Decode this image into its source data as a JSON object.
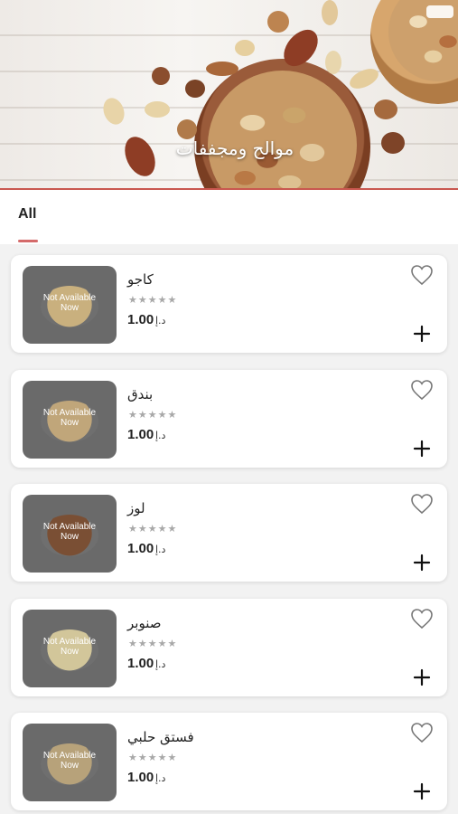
{
  "banner": {
    "title": "موالح ومجففات"
  },
  "tabs": [
    {
      "label": "All"
    }
  ],
  "products": [
    {
      "name": "كاجو",
      "stars": "★★★★★",
      "price": "1.00",
      "currency": "د.إ",
      "status": "Not Available Now",
      "image_icon": "cashew-bowl"
    },
    {
      "name": "بندق",
      "stars": "★★★★★",
      "price": "1.00",
      "currency": "د.إ",
      "status": "Not Available Now",
      "image_icon": "hazelnut-bowl"
    },
    {
      "name": "لوز",
      "stars": "★★★★★",
      "price": "1.00",
      "currency": "د.إ",
      "status": "Not Available Now",
      "image_icon": "almond-bowl"
    },
    {
      "name": "صنوبر",
      "stars": "★★★★★",
      "price": "1.00",
      "currency": "د.إ",
      "status": "Not Available Now",
      "image_icon": "pine-nut-bowl"
    },
    {
      "name": "فستق حلبي",
      "stars": "★★★★★",
      "price": "1.00",
      "currency": "د.إ",
      "status": "Not Available Now",
      "image_icon": "pistachio-bowl"
    }
  ],
  "colors": {
    "accent": "#d46a6a",
    "star": "#a8a8a8"
  }
}
